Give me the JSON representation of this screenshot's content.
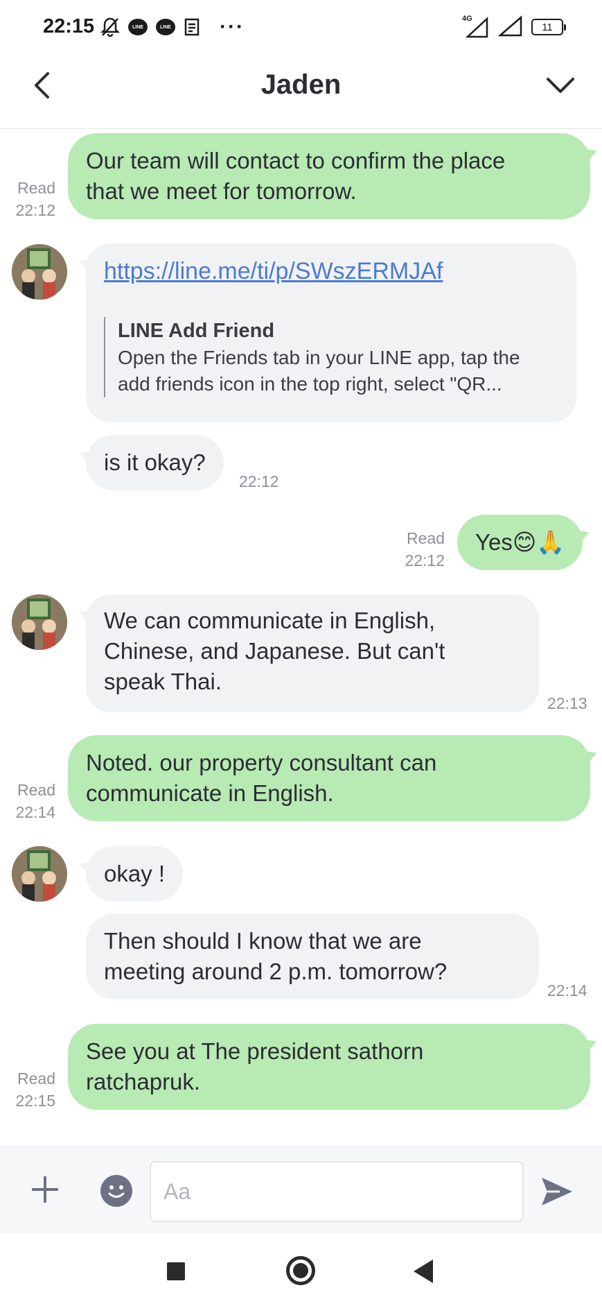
{
  "status_bar": {
    "time": "22:15",
    "icons": [
      "mute-icon",
      "line-notification-icon",
      "line-notification-icon",
      "notes-icon",
      "more-dots"
    ],
    "network": "4G",
    "battery": "11"
  },
  "header": {
    "title": "Jaden"
  },
  "messages": [
    {
      "id": 1,
      "direction": "out",
      "text_lines": [
        "Our team will contact to confirm the place",
        "that we meet for tomorrow."
      ],
      "read": "Read",
      "time": "22:12"
    },
    {
      "id": 2,
      "direction": "in",
      "type": "link",
      "link": "https://line.me/ti/p/SWszERMJAf",
      "preview_title": "LINE Add Friend",
      "preview_lines": [
        "Open the Friends tab in your LINE app, tap the",
        "add friends icon in the top right, select \"QR..."
      ]
    },
    {
      "id": 3,
      "direction": "in",
      "text": "is it okay?",
      "time": "22:12"
    },
    {
      "id": 4,
      "direction": "out",
      "text": "Yes😊🙏",
      "read": "Read",
      "time": "22:12"
    },
    {
      "id": 5,
      "direction": "in",
      "text_lines": [
        "We can communicate in English,",
        "Chinese, and Japanese. But  can't",
        "speak Thai."
      ],
      "time": "22:13"
    },
    {
      "id": 6,
      "direction": "out",
      "text_lines": [
        "Noted. our property consultant can",
        "communicate in English."
      ],
      "read": "Read",
      "time": "22:14"
    },
    {
      "id": 7,
      "direction": "in",
      "text": "okay !"
    },
    {
      "id": 8,
      "direction": "in",
      "text_lines": [
        "Then should I know that we are",
        "meeting around 2 p.m. tomorrow?"
      ],
      "time": "22:14"
    },
    {
      "id": 9,
      "direction": "out",
      "text_lines": [
        "See you at The president sathorn",
        "ratchapruk."
      ],
      "read": "Read",
      "time": "22:15"
    }
  ],
  "input_bar": {
    "placeholder": "Aa"
  },
  "colors": {
    "outgoing_bubble": "#b8eab4",
    "incoming_bubble": "#f1f2f4",
    "link": "#4b7bd3",
    "meta_text": "#8e9096"
  }
}
